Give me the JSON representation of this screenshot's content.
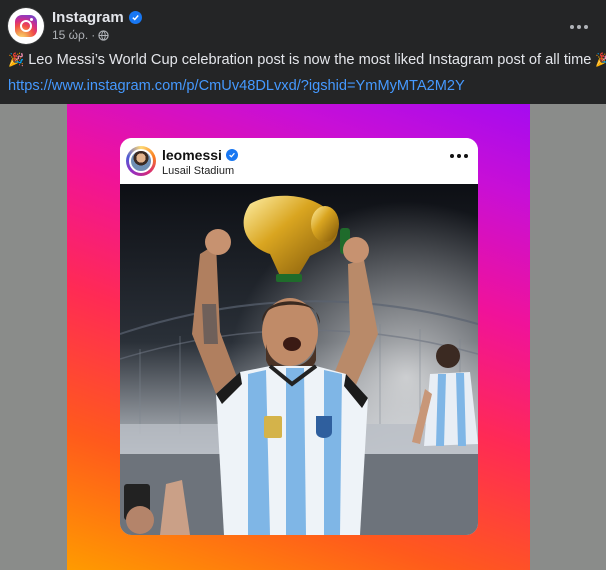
{
  "post": {
    "page_name": "Instagram",
    "time": "15 ώρ.",
    "separator": "·",
    "text": "Leo Messi’s World Cup celebration post is now the most liked Instagram post of all time",
    "emoji": "🎉",
    "link": "https://www.instagram.com/p/CmUv48DLvxd/?igshid=YmMyMTA2M2Y"
  },
  "embed": {
    "username": "leomessi",
    "location": "Lusail Stadium"
  },
  "colors": {
    "background": "#242526",
    "link": "#4599ff",
    "verified": "#1877f2",
    "frame_gradient_start": "#ff9b00",
    "frame_gradient_end": "#a50bf0",
    "jersey_stripe": "#7fb6e6"
  },
  "icons": [
    "instagram-logo-icon",
    "verified-badge-icon",
    "globe-icon",
    "more-options-icon",
    "party-popper-icon"
  ]
}
